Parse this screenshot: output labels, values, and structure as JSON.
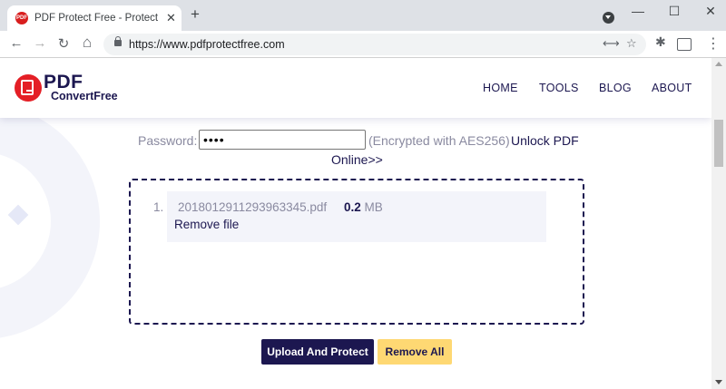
{
  "browser": {
    "tab": {
      "favicon_text": "PDF",
      "title": "PDF Protect Free - Protect Mult",
      "close": "✕"
    },
    "newtab": "+",
    "window": {
      "minimize": "—",
      "maximize": "☐",
      "close": "✕"
    },
    "nav": {
      "back": "←",
      "forward": "→",
      "reload": "↻",
      "home": "⌂"
    },
    "url": "https://www.pdfprotectfree.com",
    "icons": {
      "translate": "⟷",
      "star": "☆",
      "extensions": "✱",
      "menu": "⋮"
    }
  },
  "site": {
    "logo": {
      "line1": "PDF",
      "line2": "ConvertFree"
    },
    "nav": [
      {
        "label": "HOME"
      },
      {
        "label": "TOOLS"
      },
      {
        "label": "BLOG"
      },
      {
        "label": "ABOUT"
      }
    ]
  },
  "form": {
    "password_label": "Password:",
    "password_value": "••••",
    "note": "(Encrypted with AES256)",
    "unlock_link_line1": "Unlock PDF",
    "unlock_link_line2": "Online>>"
  },
  "files": [
    {
      "index": "1.",
      "name": "2018012911293963345.pdf",
      "size_num": "0.2",
      "size_unit": "MB",
      "remove_label": "Remove file"
    }
  ],
  "buttons": {
    "upload": "Upload And Protect",
    "remove_all": "Remove All"
  },
  "colors": {
    "brand_navy": "#1c1750",
    "accent_yellow": "#fed873",
    "logo_red": "#e41f26"
  }
}
